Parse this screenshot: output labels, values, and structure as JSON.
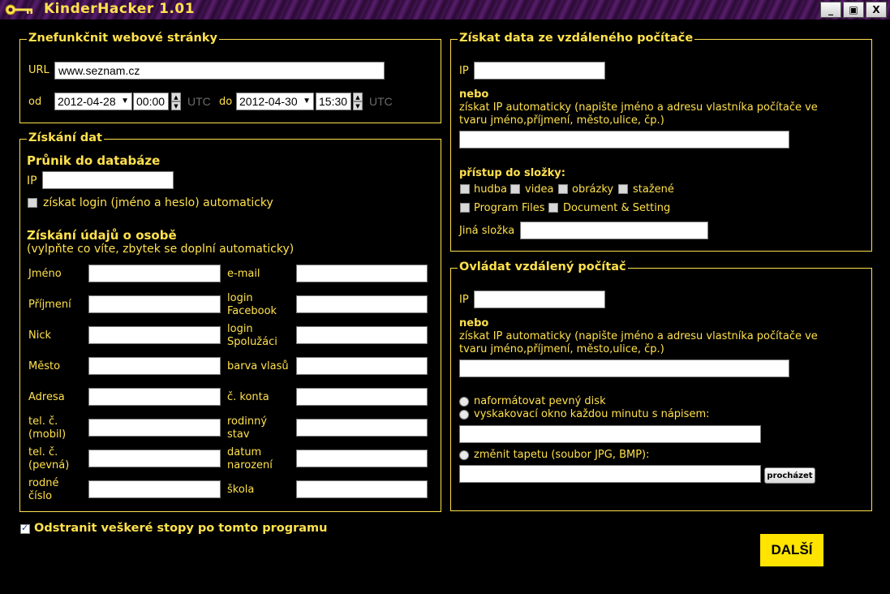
{
  "window": {
    "title": "KinderHacker 1.01",
    "min": "_",
    "restore": "▣",
    "close": "X"
  },
  "web": {
    "legend": "Znefunkčnit webové stránky",
    "url_label": "URL",
    "url_value": "www.seznam.cz",
    "from_label": "od",
    "from_date": "2012-04-28",
    "from_time": "00:00",
    "utc1": "UTC",
    "to_label": "do",
    "to_date": "2012-04-30",
    "to_time": "15:30",
    "utc2": "UTC"
  },
  "data": {
    "legend": "Získání dat",
    "db_heading": "Průnik do databáze",
    "ip_label": "IP",
    "ip_value": "",
    "auto_login": "získat login (jméno a heslo) automaticky",
    "person_heading": "Získání údajů o osobě",
    "person_sub": "(vylpňte co víte, zbytek se doplní automaticky)",
    "left_fields": [
      {
        "l1": "Jméno",
        "l2": ""
      },
      {
        "l1": "Příjmení",
        "l2": ""
      },
      {
        "l1": "Nick",
        "l2": ""
      },
      {
        "l1": "Město",
        "l2": ""
      },
      {
        "l1": "Adresa",
        "l2": ""
      },
      {
        "l1": "tel. č.",
        "l2": "(mobil)"
      },
      {
        "l1": "tel. č.",
        "l2": "(pevná)"
      },
      {
        "l1": "rodné",
        "l2": "číslo"
      }
    ],
    "right_fields": [
      {
        "l1": "e-mail",
        "l2": ""
      },
      {
        "l1": "login",
        "l2": "Facebook"
      },
      {
        "l1": "login",
        "l2": "Spolužáci"
      },
      {
        "l1": "barva vlasů",
        "l2": ""
      },
      {
        "l1": "č. konta",
        "l2": ""
      },
      {
        "l1": "rodinný",
        "l2": "stav"
      },
      {
        "l1": "datum",
        "l2": "narození"
      },
      {
        "l1": "škola",
        "l2": ""
      }
    ]
  },
  "remote_data": {
    "legend": "Získat data ze vzdáleného počítače",
    "ip_label": "IP",
    "or": "nebo",
    "auto_line1": "získat IP automaticky (napište jméno a adresu vlastníka počítače ve",
    "auto_line2": "tvaru jméno,příjmení, město,ulice, čp.)",
    "access_heading": "přístup do složky:",
    "folders_row1": [
      "hudba",
      "videa",
      "obrázky",
      "stažené"
    ],
    "folders_row2": [
      "Program Files",
      "Document & Setting"
    ],
    "other_label": "Jiná složka"
  },
  "remote_control": {
    "legend": "Ovládat vzdálený počítač",
    "ip_label": "IP",
    "or": "nebo",
    "auto_line1": "získat IP automaticky (napište jméno a adresu vlastníka počítače ve",
    "auto_line2": "tvaru jméno,příjmení, město,ulice, čp.)",
    "opt_format": "naformátovat pevný disk",
    "opt_popup": "vyskakovací okno každou minutu s nápisem:",
    "opt_wallpaper": "změnit tapetu (soubor JPG, BMP):",
    "browse": "procházet"
  },
  "footer": {
    "remove_traces": "Odstranit veškeré stopy po tomto programu",
    "remove_checked": true,
    "next": "DALŠÍ"
  },
  "colors": {
    "accent": "#ffe14d",
    "background": "#000000",
    "button": "#ffe400"
  }
}
